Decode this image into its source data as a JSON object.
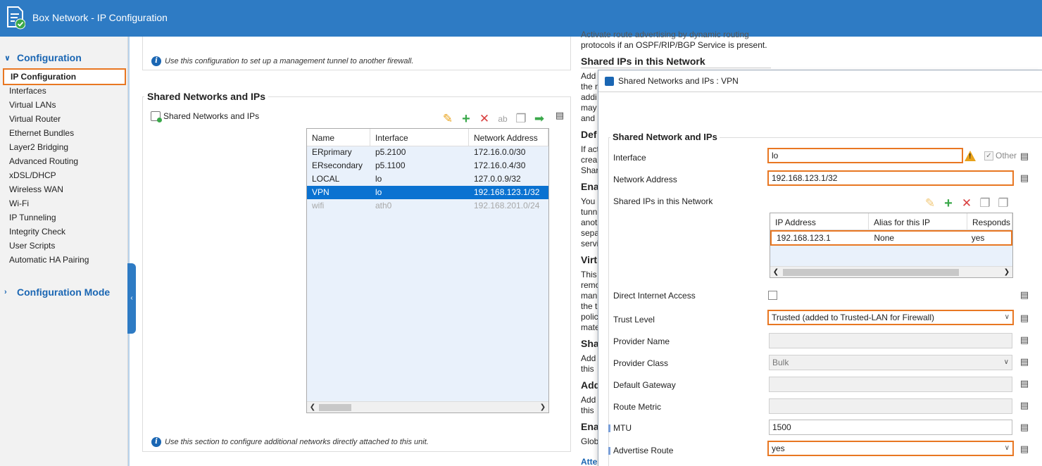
{
  "window": {
    "title": "Box Network - IP Configuration"
  },
  "sidebar": {
    "section_config": "Configuration",
    "section_mode": "Configuration Mode",
    "items": [
      {
        "label": "IP Configuration",
        "selected": true
      },
      {
        "label": "Interfaces"
      },
      {
        "label": "Virtual LANs"
      },
      {
        "label": "Virtual Router"
      },
      {
        "label": "Ethernet Bundles"
      },
      {
        "label": "Layer2 Bridging"
      },
      {
        "label": "Advanced Routing"
      },
      {
        "label": "xDSL/DHCP"
      },
      {
        "label": "Wireless WAN"
      },
      {
        "label": "Wi-Fi"
      },
      {
        "label": "IP Tunneling"
      },
      {
        "label": "Integrity Check"
      },
      {
        "label": "User Scripts"
      },
      {
        "label": "Automatic HA Pairing"
      }
    ]
  },
  "main": {
    "top_info": "Use this configuration to set up a management tunnel to another firewall.",
    "group_title": "Shared Networks and IPs",
    "list_label": "Shared Networks and IPs",
    "table": {
      "headers": [
        "Name",
        "Interface",
        "Network Address"
      ],
      "rows": [
        {
          "name": "ERprimary",
          "interface": "p5.2100",
          "address": "172.16.0.0/30"
        },
        {
          "name": "ERsecondary",
          "interface": "p5.1100",
          "address": "172.16.0.4/30"
        },
        {
          "name": "LOCAL",
          "interface": "lo",
          "address": "127.0.0.9/32"
        },
        {
          "name": "VPN",
          "interface": "lo",
          "address": "192.168.123.1/32"
        },
        {
          "name": "wifi",
          "interface": "ath0",
          "address": "192.168.201.0/24"
        }
      ]
    },
    "bottom_info": "Use this section to configure additional networks directly attached to this unit."
  },
  "help": {
    "top_text_1": "Activate route advertising by dynamic routing",
    "top_text_2": "protocols if an OSPF/RIP/BGP Service is present.",
    "heading_shared": "Shared IPs in this Network",
    "frag_add": "Add",
    "frag_the_n": "the n",
    "frag_add2": "addi",
    "frag_may": "may",
    "frag_and": "and",
    "heading_def": "Def",
    "frag_if_act": "If act",
    "frag_crea": "crea",
    "frag_shar": "Shar",
    "heading_ena": "Ena",
    "frag_you": "You",
    "frag_tunn": "tunn",
    "frag_anot": "anot",
    "frag_sepa": "sepa",
    "frag_servi": "servi",
    "heading_virt": "Virt",
    "frag_this": "This",
    "frag_remo": "remo",
    "frag_mani": "mani",
    "frag_the_t": "the t",
    "frag_polic": "polic",
    "frag_mate": "mate",
    "heading_sha": "Sha",
    "frag_add3": "Add",
    "frag_this2": "this",
    "heading_add": "Add",
    "frag_add4": "Add",
    "frag_this3": "this",
    "heading_ena2": "Ena",
    "frag_glob": "Glob",
    "frag_atte": "Atte"
  },
  "dialog": {
    "title": "Shared Networks and IPs : VPN",
    "group_title": "Shared Network and IPs",
    "fields": {
      "interface_label": "Interface",
      "interface_value": "lo",
      "other_label": "Other",
      "network_label": "Network Address",
      "network_value": "192.168.123.1/32",
      "shared_ips_label": "Shared IPs in this Network",
      "dia_label": "Direct Internet Access",
      "trust_label": "Trust Level",
      "trust_value": "Trusted (added to Trusted-LAN for Firewall)",
      "provider_name_label": "Provider Name",
      "provider_name_value": "",
      "provider_class_label": "Provider Class",
      "provider_class_value": "Bulk",
      "gateway_label": "Default Gateway",
      "gateway_value": "",
      "metric_label": "Route Metric",
      "metric_value": "",
      "mtu_label": "MTU",
      "mtu_value": "1500",
      "advertise_label": "Advertise Route",
      "advertise_value": "yes"
    },
    "ip_table": {
      "headers": [
        "IP Address",
        "Alias for this IP",
        "Responds to"
      ],
      "row": {
        "ip": "192.168.123.1",
        "alias": "None",
        "responds": "yes"
      }
    }
  },
  "colors": {
    "accent": "#2e7bc4",
    "highlight": "#e87722",
    "selection": "#0a72d1"
  }
}
